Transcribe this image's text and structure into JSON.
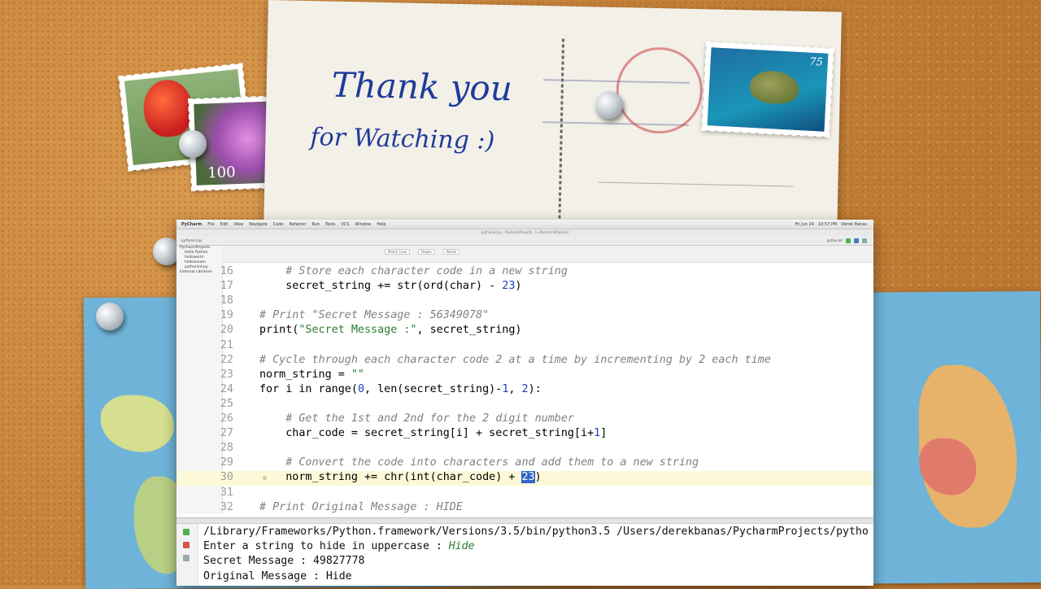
{
  "postcard": {
    "line1": "Thank you",
    "line2": "for Watching :)",
    "stamp_value_turtle": "75",
    "stamp_value_flower": "100"
  },
  "ide": {
    "menu": [
      "PyCharm",
      "File",
      "Edit",
      "View",
      "Navigate",
      "Code",
      "Refactor",
      "Run",
      "Tools",
      "VCS",
      "Window",
      "Help"
    ],
    "menu_right": [
      "Fri Jun 24",
      "10:57 PM",
      "Derek Banas"
    ],
    "window_title": "pythonint.py - PycharmProjects - [~/PycharmProjects]",
    "project_name": "pythonint.py",
    "project_tree": [
      "PycharmProjects",
      "Hello Python",
      "helloworld",
      "hellosexam",
      "pythonint.py",
      "External Libraries"
    ],
    "find_fields": [
      "Match Case",
      "Regex",
      "Words"
    ],
    "run_config": "pythonint",
    "code_lines": [
      {
        "n": "16",
        "indent": "    ",
        "parts": [
          {
            "t": "# Store each character code in a new string",
            "c": "comment"
          }
        ]
      },
      {
        "n": "17",
        "indent": "    ",
        "parts": [
          {
            "t": "secret_string += str(ord(char) - ",
            "c": ""
          },
          {
            "t": "23",
            "c": "num"
          },
          {
            "t": ")",
            "c": ""
          }
        ]
      },
      {
        "n": "18",
        "indent": "",
        "parts": []
      },
      {
        "n": "19",
        "indent": "",
        "parts": [
          {
            "t": "# Print \"Secret Message : 56349078\"",
            "c": "comment"
          }
        ]
      },
      {
        "n": "20",
        "indent": "",
        "parts": [
          {
            "t": "print(",
            "c": ""
          },
          {
            "t": "\"Secret Message :\"",
            "c": "str"
          },
          {
            "t": ", secret_string)",
            "c": ""
          }
        ]
      },
      {
        "n": "21",
        "indent": "",
        "parts": []
      },
      {
        "n": "22",
        "indent": "",
        "parts": [
          {
            "t": "# Cycle through each character code 2 at a time by incrementing by 2 each time",
            "c": "comment"
          }
        ]
      },
      {
        "n": "23",
        "indent": "",
        "parts": [
          {
            "t": "norm_string = ",
            "c": ""
          },
          {
            "t": "\"\"",
            "c": "str"
          }
        ]
      },
      {
        "n": "24",
        "indent": "",
        "parts": [
          {
            "t": "for i in range(",
            "c": ""
          },
          {
            "t": "0",
            "c": "num"
          },
          {
            "t": ", len(secret_string)-",
            "c": ""
          },
          {
            "t": "1",
            "c": "num"
          },
          {
            "t": ", ",
            "c": ""
          },
          {
            "t": "2",
            "c": "num"
          },
          {
            "t": "):",
            "c": ""
          }
        ]
      },
      {
        "n": "25",
        "indent": "",
        "parts": []
      },
      {
        "n": "26",
        "indent": "    ",
        "parts": [
          {
            "t": "# Get the 1st and 2nd for the 2 digit number",
            "c": "comment"
          }
        ]
      },
      {
        "n": "27",
        "indent": "    ",
        "parts": [
          {
            "t": "char_code = secret_string[i] + secret_string[i+",
            "c": ""
          },
          {
            "t": "1",
            "c": "num"
          },
          {
            "t": "]",
            "c": ""
          }
        ]
      },
      {
        "n": "28",
        "indent": "",
        "parts": []
      },
      {
        "n": "29",
        "indent": "    ",
        "parts": [
          {
            "t": "# Convert the code into characters and add them to a new string",
            "c": "comment"
          }
        ]
      },
      {
        "n": "30",
        "indent": "    ",
        "current": true,
        "parts": [
          {
            "t": "norm_string += chr(int(char_code) + ",
            "c": ""
          },
          {
            "t": "23",
            "c": "sel"
          },
          {
            "t": ")",
            "c": ""
          }
        ]
      },
      {
        "n": "31",
        "indent": "",
        "parts": []
      },
      {
        "n": "32",
        "indent": "",
        "parts": [
          {
            "t": "# Print Original Message : HIDE",
            "c": "comment"
          }
        ]
      }
    ],
    "run_lines": [
      {
        "parts": [
          {
            "t": "/Library/Frameworks/Python.framework/Versions/3.5/bin/python3.5 /Users/derekbanas/PycharmProjects/pytho",
            "c": ""
          }
        ]
      },
      {
        "parts": [
          {
            "t": "Enter a string to hide in uppercase : ",
            "c": ""
          },
          {
            "t": "Hide",
            "c": "input-txt"
          }
        ]
      },
      {
        "parts": [
          {
            "t": "Secret Message : 49827778",
            "c": ""
          }
        ]
      },
      {
        "parts": [
          {
            "t": "Original Message : Hide",
            "c": ""
          }
        ]
      }
    ]
  },
  "colors": {
    "comment": "#808080",
    "string": "#2e7d32",
    "number": "#1a3fb8",
    "selection": "#2f65ca",
    "current_line": "#fdf9d8"
  }
}
